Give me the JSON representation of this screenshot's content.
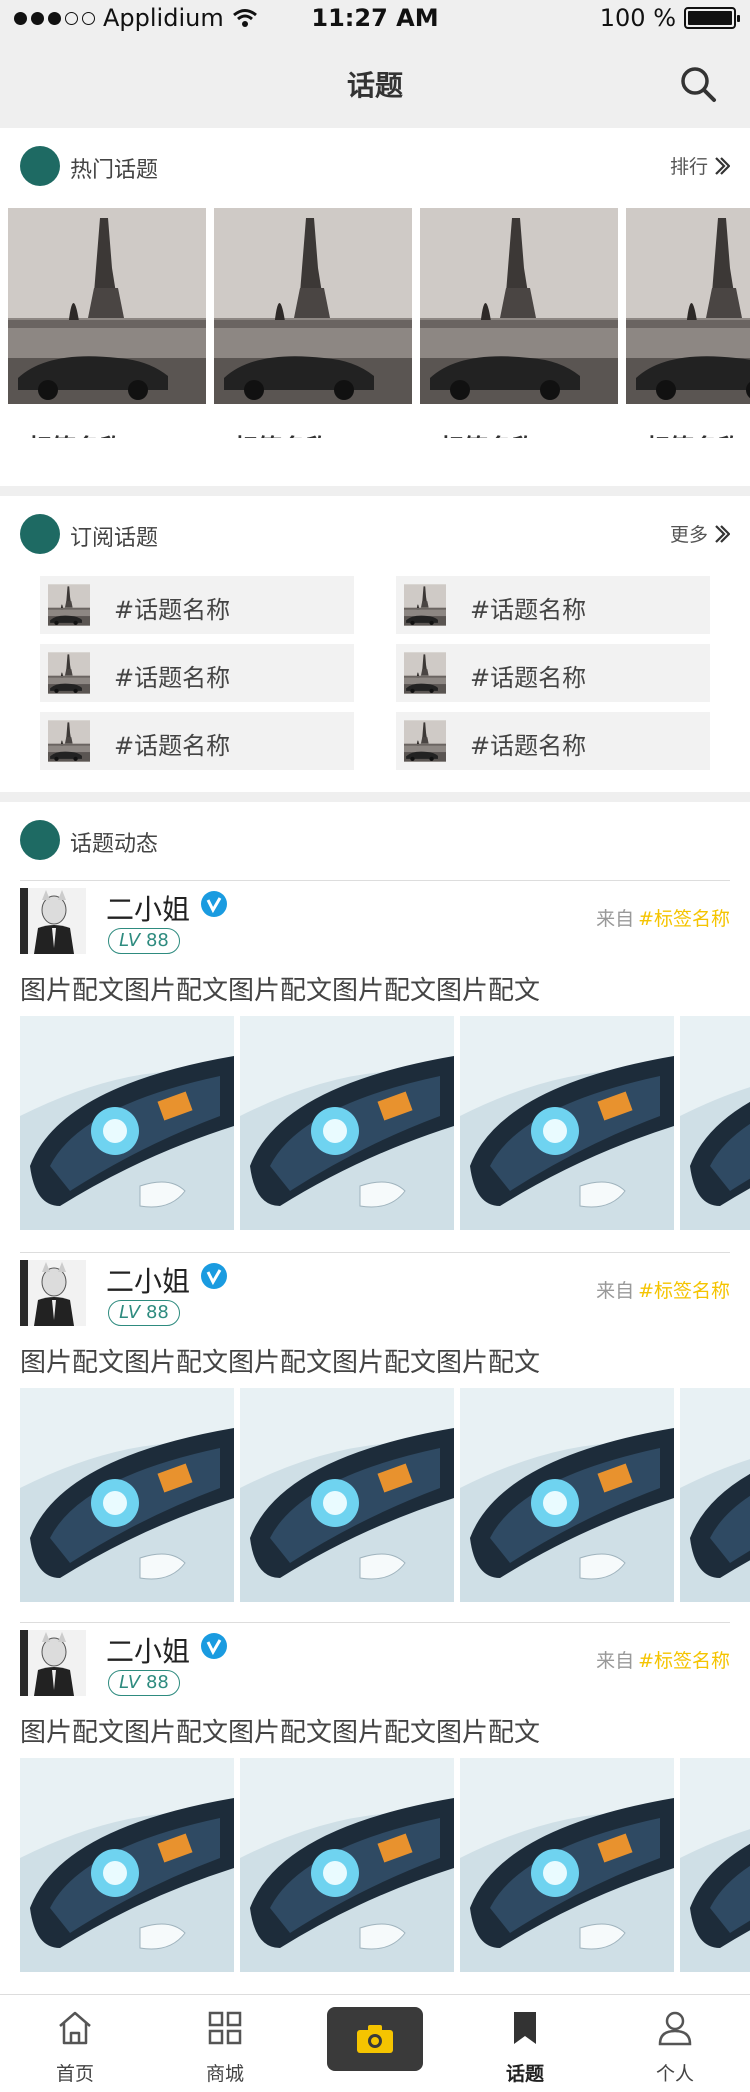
{
  "status_bar": {
    "carrier": "Applidium",
    "time": "11:27 AM",
    "battery": "100 %"
  },
  "nav": {
    "title": "话题"
  },
  "hot_topics": {
    "title": "热门话题",
    "more_label": "排行",
    "items": [
      {
        "label": "#标签名称"
      },
      {
        "label": "#标签名称"
      },
      {
        "label": "#标签名称"
      },
      {
        "label": "#标签名称"
      }
    ]
  },
  "subscribed": {
    "title": "订阅话题",
    "more_label": "更多",
    "items": [
      {
        "label": "#话题名称"
      },
      {
        "label": "#话题名称"
      },
      {
        "label": "#话题名称"
      },
      {
        "label": "#话题名称"
      },
      {
        "label": "#话题名称"
      },
      {
        "label": "#话题名称"
      }
    ]
  },
  "feed": {
    "title": "话题动态",
    "posts": [
      {
        "user": "二小姐",
        "level": "88",
        "from_label": "来自",
        "tag": "#标签名称",
        "caption": "图片配文图片配文图片配文图片配文图片配文"
      },
      {
        "user": "二小姐",
        "level": "88",
        "from_label": "来自",
        "tag": "#标签名称",
        "caption": "图片配文图片配文图片配文图片配文图片配文"
      },
      {
        "user": "二小姐",
        "level": "88",
        "from_label": "来自",
        "tag": "#标签名称",
        "caption": "图片配文图片配文图片配文图片配文图片配文"
      }
    ],
    "level_prefix": "LV"
  },
  "tabbar": {
    "items": [
      {
        "label": "首页",
        "icon": "home-icon"
      },
      {
        "label": "商城",
        "icon": "grid-icon"
      },
      {
        "label": "",
        "icon": "camera-icon"
      },
      {
        "label": "话题",
        "icon": "bookmark-icon",
        "active": true
      },
      {
        "label": "个人",
        "icon": "person-icon"
      }
    ]
  },
  "colors": {
    "accent": "#1e6a63",
    "tag": "#f5c400",
    "camera_bg": "#3a3a3a"
  }
}
